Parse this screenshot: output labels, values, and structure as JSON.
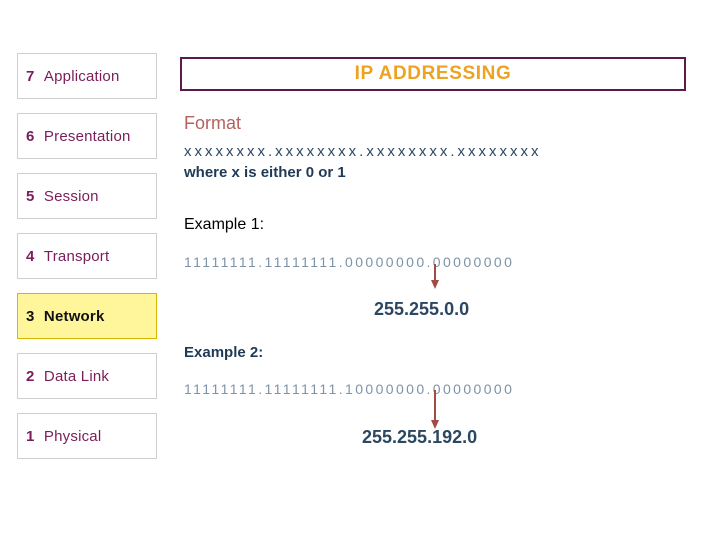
{
  "slide": {
    "title": "IP ADDRESSING",
    "colors": {
      "title_text": "#eea221",
      "title_border": "#5b1b47",
      "osi_text": "#7a1d5a",
      "osi_border": "#cfcfcf",
      "osi_active_fill": "#fff59a",
      "osi_active_border": "#d6b800",
      "osi_active_text": "#111111",
      "heading": "#b5625e",
      "body_text": "#1f3a57",
      "binary_text": "#7e93a6",
      "arrow": "#a04b46",
      "background": "#ffffff"
    }
  },
  "osi_stack": {
    "items": [
      {
        "number": "7",
        "name": "Application",
        "active": false
      },
      {
        "number": "6",
        "name": "Presentation",
        "active": false
      },
      {
        "number": "5",
        "name": "Session",
        "active": false
      },
      {
        "number": "4",
        "name": "Transport",
        "active": false
      },
      {
        "number": "3",
        "name": "Network",
        "active": true
      },
      {
        "number": "2",
        "name": "Data Link",
        "active": false
      },
      {
        "number": "1",
        "name": "Physical",
        "active": false
      }
    ]
  },
  "body": {
    "format_heading": "Format",
    "format_pattern": "xxxxxxxx.xxxxxxxx.xxxxxxxx.xxxxxxxx",
    "format_note": "where x is either 0 or 1",
    "example1_label": "Example 1:",
    "example1_binary": "11111111.11111111.00000000.00000000",
    "example1_result": "255.255.0.0",
    "example2_label": "Example 2:",
    "example2_binary": "11111111.11111111.10000000.00000000",
    "example2_result": "255.255.192.0"
  },
  "icons": {
    "arrow_down": "down-arrow-icon"
  }
}
